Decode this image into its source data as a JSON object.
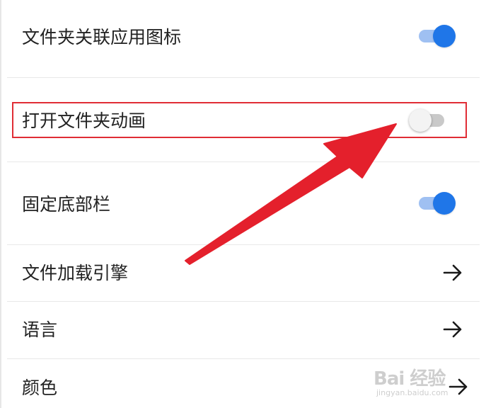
{
  "settings": {
    "items": [
      {
        "label": "文件夹关联应用图标",
        "control": "switch",
        "state": "on"
      },
      {
        "label": "打开文件夹动画",
        "control": "switch",
        "state": "off"
      },
      {
        "label": "固定底部栏",
        "control": "switch",
        "state": "on"
      },
      {
        "label": "文件加载引擎",
        "control": "arrow"
      },
      {
        "label": "语言",
        "control": "arrow"
      },
      {
        "label": "颜色",
        "control": "arrow"
      }
    ]
  },
  "colors": {
    "switch_on_thumb": "#1f76e8",
    "switch_on_track": "#9fc0f2",
    "switch_off_thumb": "#f3f3f3",
    "switch_off_track": "#c9c9c9",
    "annotation_red": "#e02d35"
  },
  "watermark": {
    "logo_text": "Bai 经验",
    "url_text": "jingyan.baidu.com"
  },
  "icons": {
    "nav_arrow": "arrow-right-icon",
    "annotation": "red-pointer-arrow-icon"
  }
}
